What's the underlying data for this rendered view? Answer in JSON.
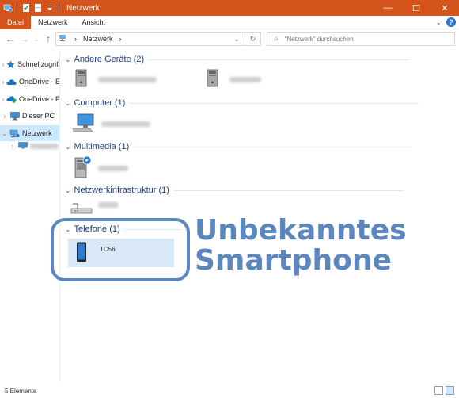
{
  "window": {
    "title": "Netzwerk",
    "minimize": "—",
    "maximize": "☐",
    "close": "✕"
  },
  "ribbon": {
    "tabs": [
      "Datei",
      "Netzwerk",
      "Ansicht"
    ],
    "expand": "⌄",
    "help": "?"
  },
  "address": {
    "root_sep": "›",
    "location": "Netzwerk",
    "after_sep": "›"
  },
  "search": {
    "placeholder": "\"Netzwerk\" durchsuchen"
  },
  "sidebar": {
    "items": [
      {
        "label": "Schnellzugriff",
        "icon": "star-icon"
      },
      {
        "label": "OneDrive - E",
        "icon": "onedrive-icon"
      },
      {
        "label": "OneDrive - P",
        "icon": "onedrive-icon"
      },
      {
        "label": "Dieser PC",
        "icon": "pc-icon"
      },
      {
        "label": "Netzwerk",
        "icon": "network-icon",
        "selected": true
      },
      {
        "label": "",
        "icon": "computer-icon"
      }
    ]
  },
  "groups": [
    {
      "title": "Andere Geräte (2)",
      "key": "other"
    },
    {
      "title": "Computer (1)",
      "key": "computer"
    },
    {
      "title": "Multimedia (1)",
      "key": "multimedia"
    },
    {
      "title": "Netzwerkinfrastruktur (1)",
      "key": "infra"
    },
    {
      "title": "Telefone (1)",
      "key": "phones"
    }
  ],
  "phone_item": {
    "label": "TC56"
  },
  "annotation": {
    "line1": "Unbekanntes",
    "line2": "Smartphone"
  },
  "status": {
    "count": "5 Elemente"
  },
  "colors": {
    "accent": "#d4541b",
    "annotation": "#5b86be",
    "group_title": "#1e3f80",
    "selection": "#cce8ff"
  }
}
